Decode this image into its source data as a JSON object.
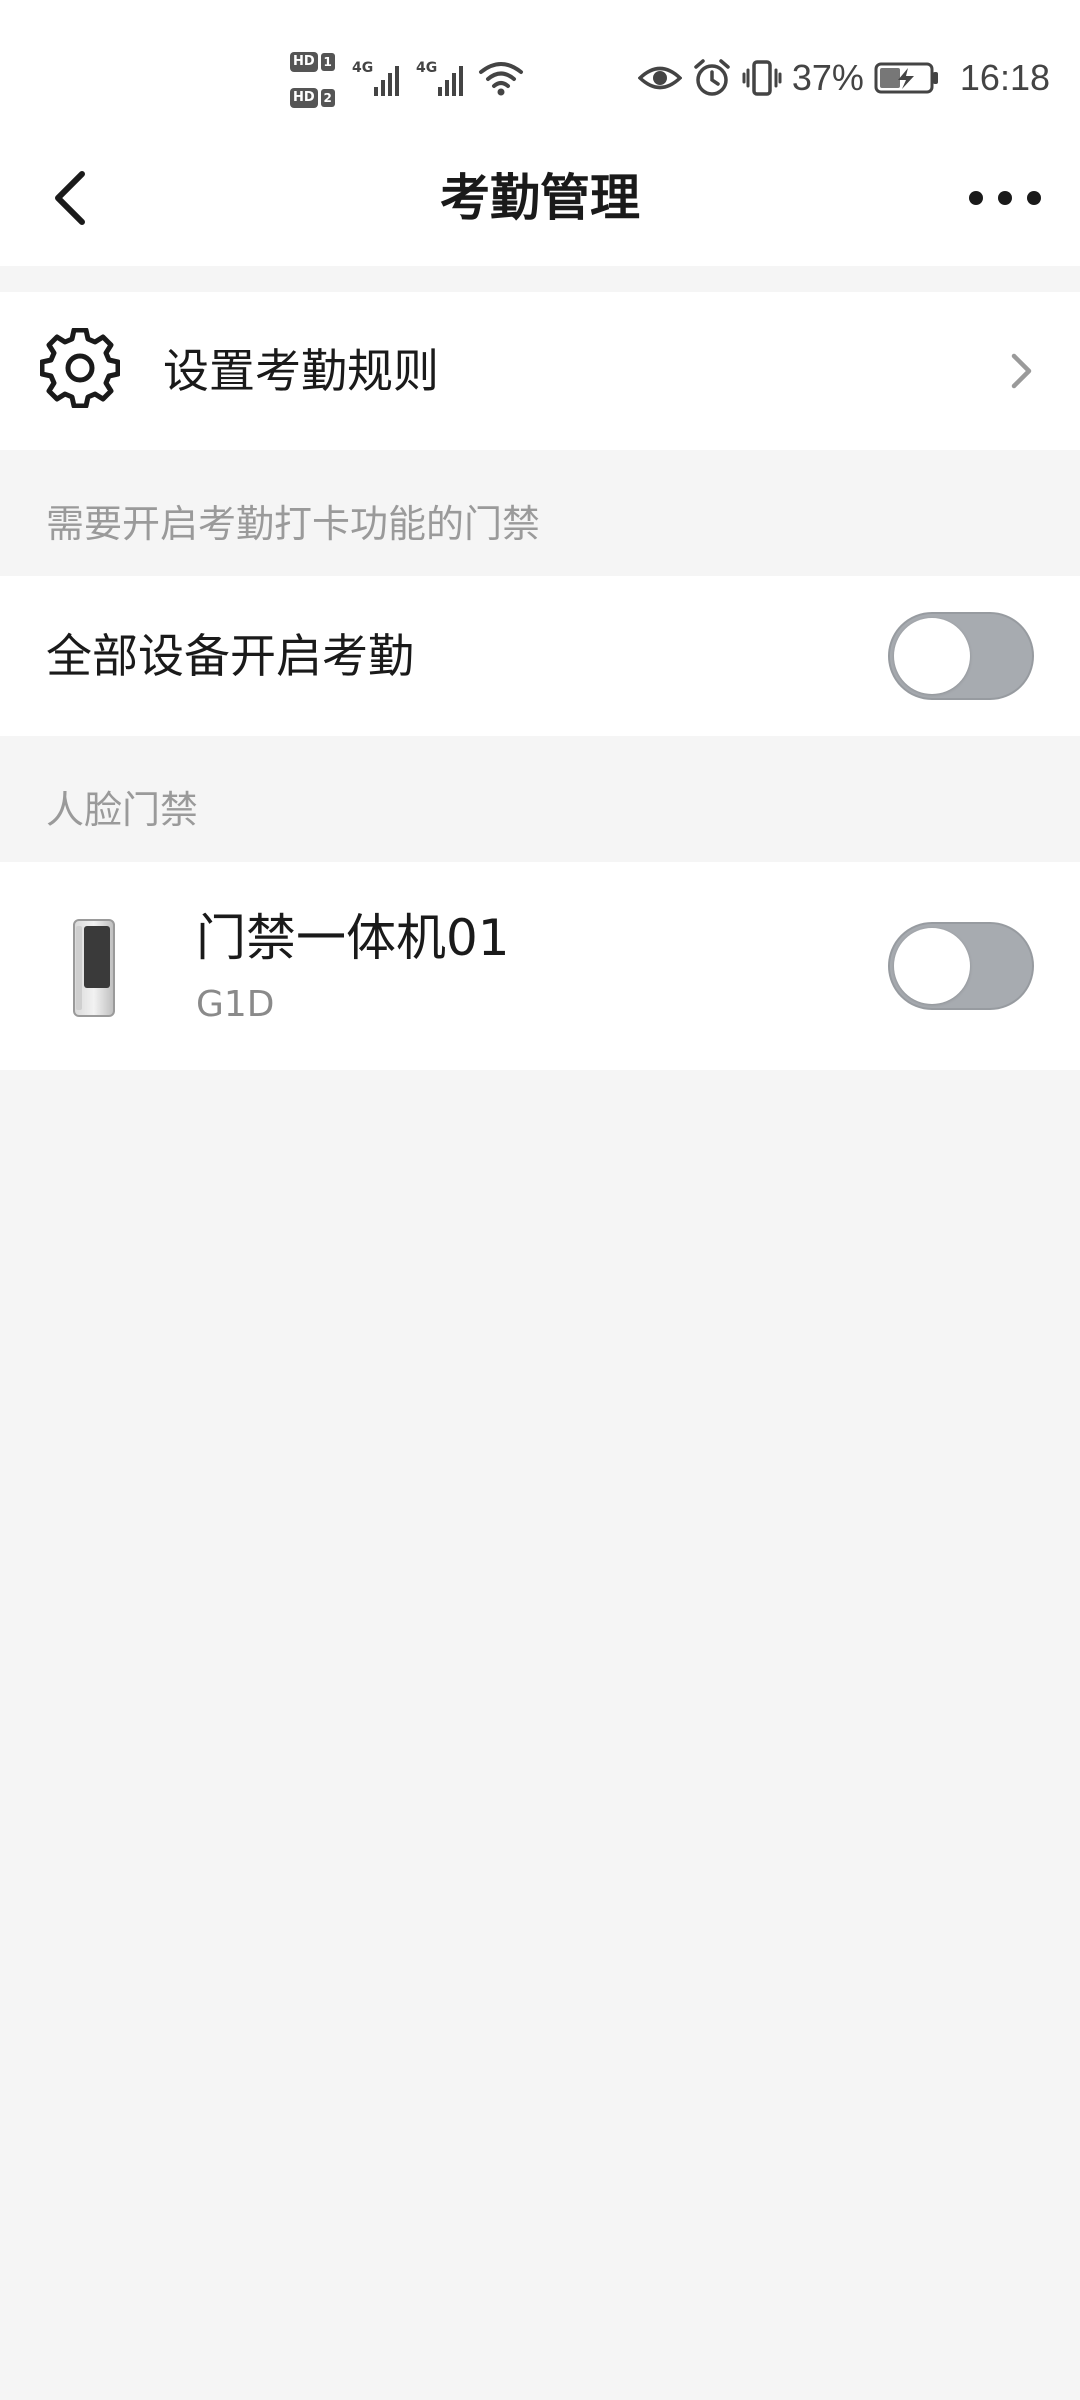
{
  "status_bar": {
    "sim1": {
      "label": "HD",
      "slot": "1",
      "network": "4G"
    },
    "sim2": {
      "label": "HD",
      "slot": "2",
      "network": "4G"
    },
    "wifi_icon": "wifi-icon",
    "icons": [
      "eye-icon",
      "alarm-icon",
      "vibrate-icon"
    ],
    "battery_percent": "37%",
    "battery_icon": "battery-charging-icon",
    "time": "16:18"
  },
  "nav": {
    "back_icon": "chevron-left-icon",
    "title": "考勤管理",
    "more_icon": "more-horizontal-icon"
  },
  "rule_row": {
    "icon": "gear-icon",
    "label": "设置考勤规则",
    "chevron_icon": "chevron-right-icon"
  },
  "section_attendance": {
    "header": "需要开启考勤打卡功能的门禁"
  },
  "all_devices": {
    "label": "全部设备开启考勤",
    "enabled": false
  },
  "section_face": {
    "header": "人脸门禁"
  },
  "devices": [
    {
      "icon": "access-control-terminal-icon",
      "name": "门禁一体机01",
      "model": "G1D",
      "enabled": false
    }
  ],
  "colors": {
    "background": "#f5f5f5",
    "card": "#ffffff",
    "section_text": "#9a9a9a",
    "switch_off": "#a7abb0"
  }
}
